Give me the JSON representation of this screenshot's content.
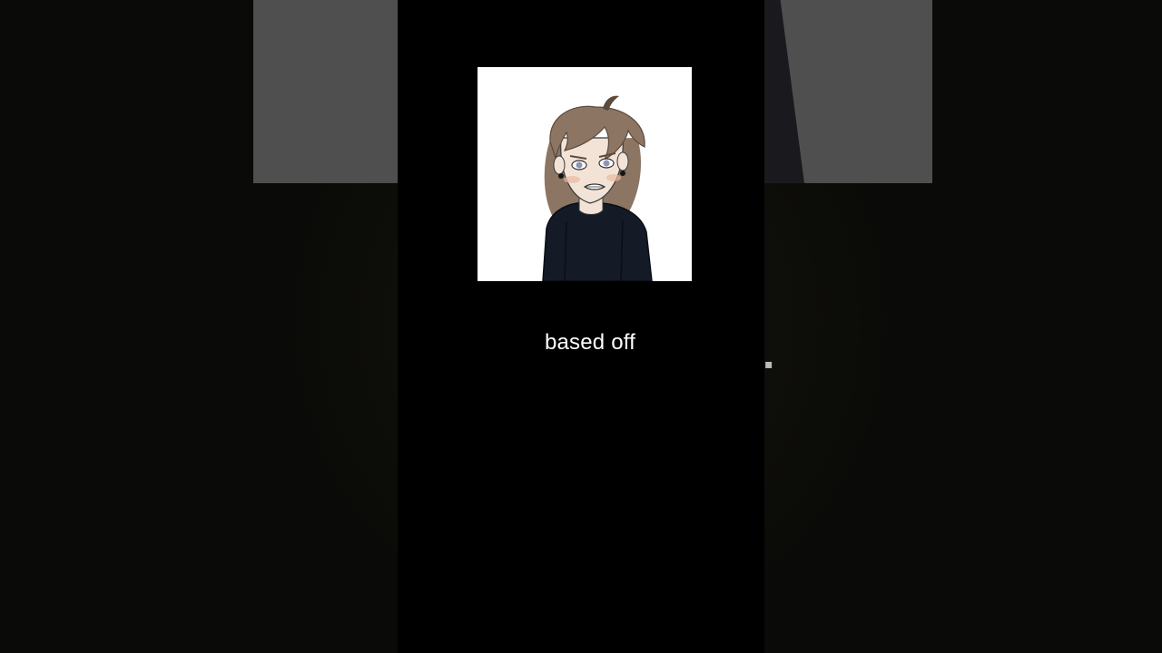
{
  "caption": {
    "text": "based off"
  },
  "artwork": {
    "subject": "cartoon-character-portrait",
    "colors": {
      "panel_bg": "#ffffff",
      "hair": "#8c7563",
      "hair_dark": "#5c4a3e",
      "skin": "#f3e3d6",
      "cheek": "#e8b9a3",
      "shirt": "#141b26",
      "eye": "#8f93b4"
    }
  },
  "colors": {
    "page_bg": "#050505",
    "side_gray": "#4f4f4f",
    "caption_text": "#ffffff"
  },
  "side_mark": {
    "glyph": "▪"
  }
}
